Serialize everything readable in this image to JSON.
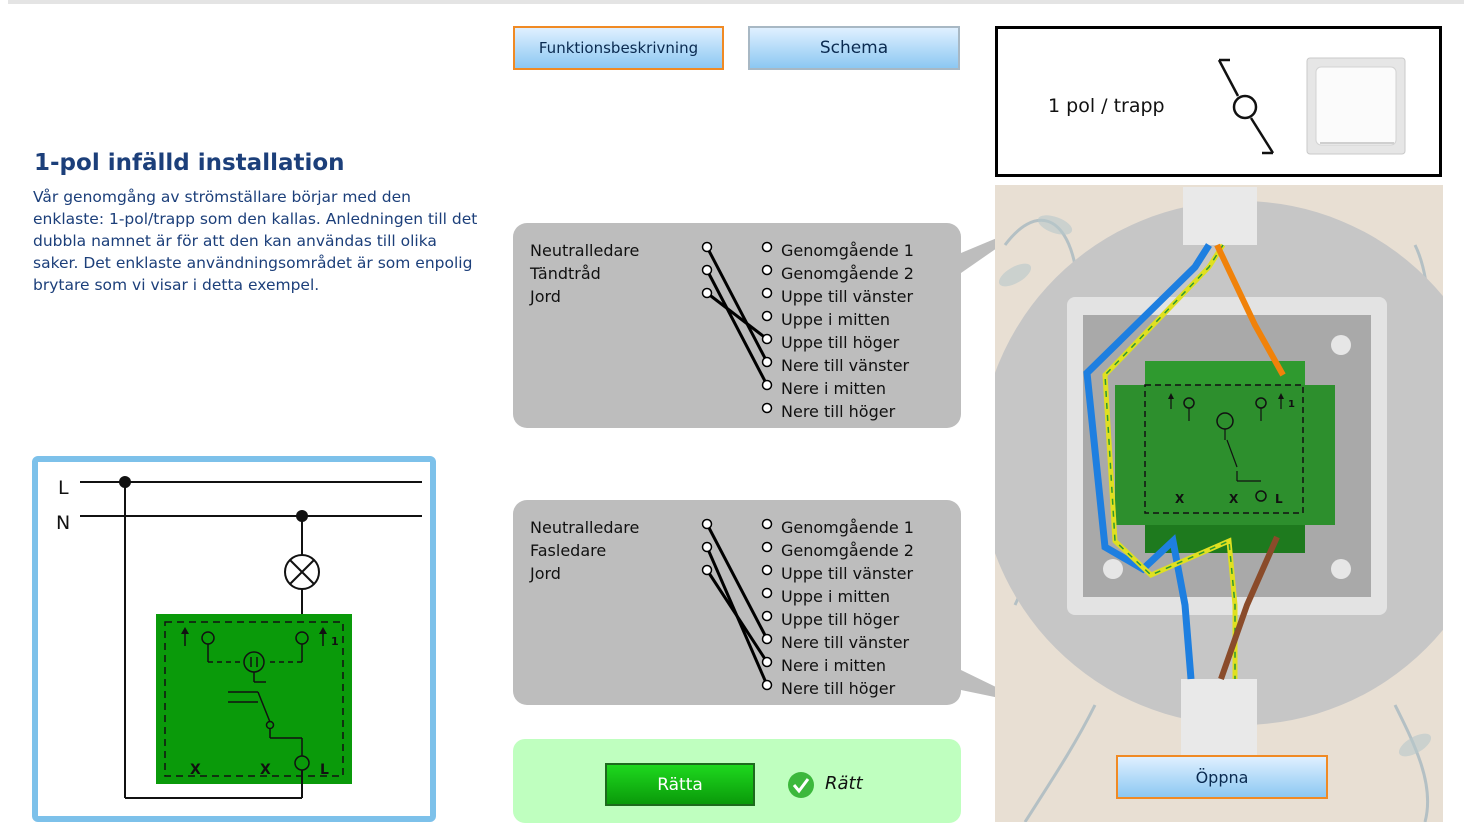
{
  "tabs": {
    "function_label": "Funktionsbeskrivning",
    "schema_label": "Schema"
  },
  "intro": {
    "title": "1-pol infälld installation",
    "text": "Vår genomgång av strömställare börjar med den enklaste: 1-pol/trapp som den kallas. Anledningen till det dubbla namnet är för att den kan användas till olika saker. Det enklaste användningsområdet är som enpolig brytare som vi visar i detta exempel."
  },
  "legend": {
    "label": "1 pol / trapp"
  },
  "upper_connections": {
    "sources": [
      "Neutralledare",
      "Tändtråd",
      "Jord"
    ],
    "targets": [
      "Genomgående 1",
      "Genomgående 2",
      "Uppe till vänster",
      "Uppe i mitten",
      "Uppe till höger",
      "Nere till vänster",
      "Nere i mitten",
      "Nere till höger"
    ]
  },
  "lower_connections": {
    "sources": [
      "Neutralledare",
      "Fasledare",
      "Jord"
    ],
    "targets": [
      "Genomgående 1",
      "Genomgående 2",
      "Uppe till vänster",
      "Uppe i mitten",
      "Uppe till höger",
      "Nere till vänster",
      "Nere i mitten",
      "Nere till höger"
    ]
  },
  "schematic": {
    "line_l": "L",
    "line_n": "N",
    "terminal_x1": "X",
    "terminal_x2": "X",
    "terminal_l": "L",
    "terminal_1": "1"
  },
  "check": {
    "button_label": "Rätta",
    "status_text": "Rätt",
    "status_color": "#3cb83c"
  },
  "photo": {
    "open_label": "Öppna",
    "terminal_x1": "X",
    "terminal_x2": "X",
    "terminal_l": "L",
    "terminal_1": "1"
  },
  "colors": {
    "title": "#1c3f7a",
    "callout_bg": "#bdbdbd",
    "result_bg": "#bfffbf",
    "switch_green": "#0a9a0a",
    "frame_blue": "#7dc1ea",
    "accent_orange": "#f08a24"
  }
}
